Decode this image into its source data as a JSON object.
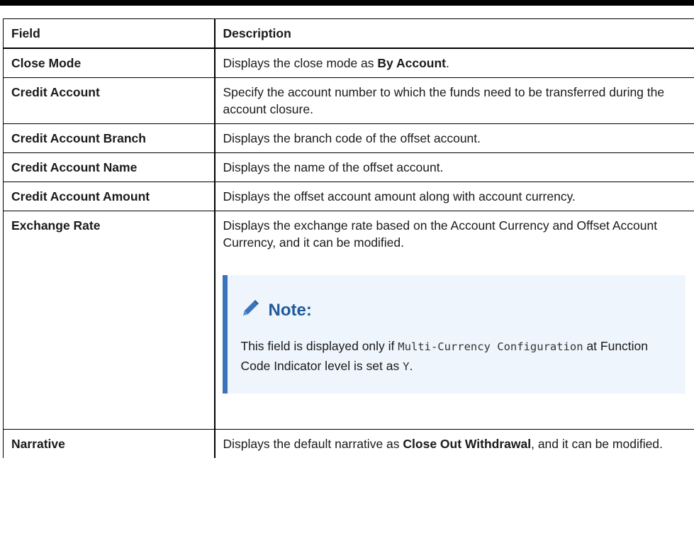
{
  "table": {
    "headers": [
      "Field",
      "Description"
    ],
    "rows": [
      {
        "field": "Close Mode",
        "desc_pre": "Displays the close mode as ",
        "desc_bold": "By Account",
        "desc_post": "."
      },
      {
        "field": "Credit Account",
        "desc": "Specify the account number to which the funds need to be transferred during the account closure."
      },
      {
        "field": "Credit Account Branch",
        "desc": "Displays the branch code of the offset account."
      },
      {
        "field": "Credit Account Name",
        "desc": "Displays the name of the offset account."
      },
      {
        "field": "Credit Account Amount",
        "desc": "Displays the offset account amount along with account currency."
      },
      {
        "field": "Exchange Rate",
        "desc": "Displays the exchange rate based on the Account Currency and Offset Account Currency, and it can be modified."
      },
      {
        "field": "Narrative",
        "desc_pre": "Displays the default narrative as ",
        "desc_bold": "Close Out Withdrawal",
        "desc_post": ", and it can be modified."
      }
    ]
  },
  "note": {
    "icon": "pencil-icon",
    "accent_color": "#3a74bd",
    "title": "Note:",
    "text_1": "This field is displayed only if ",
    "code_1": "Multi-Currency Configuration",
    "text_2": " at Function Code Indicator level is set as ",
    "code_2": "Y",
    "text_3": "."
  }
}
